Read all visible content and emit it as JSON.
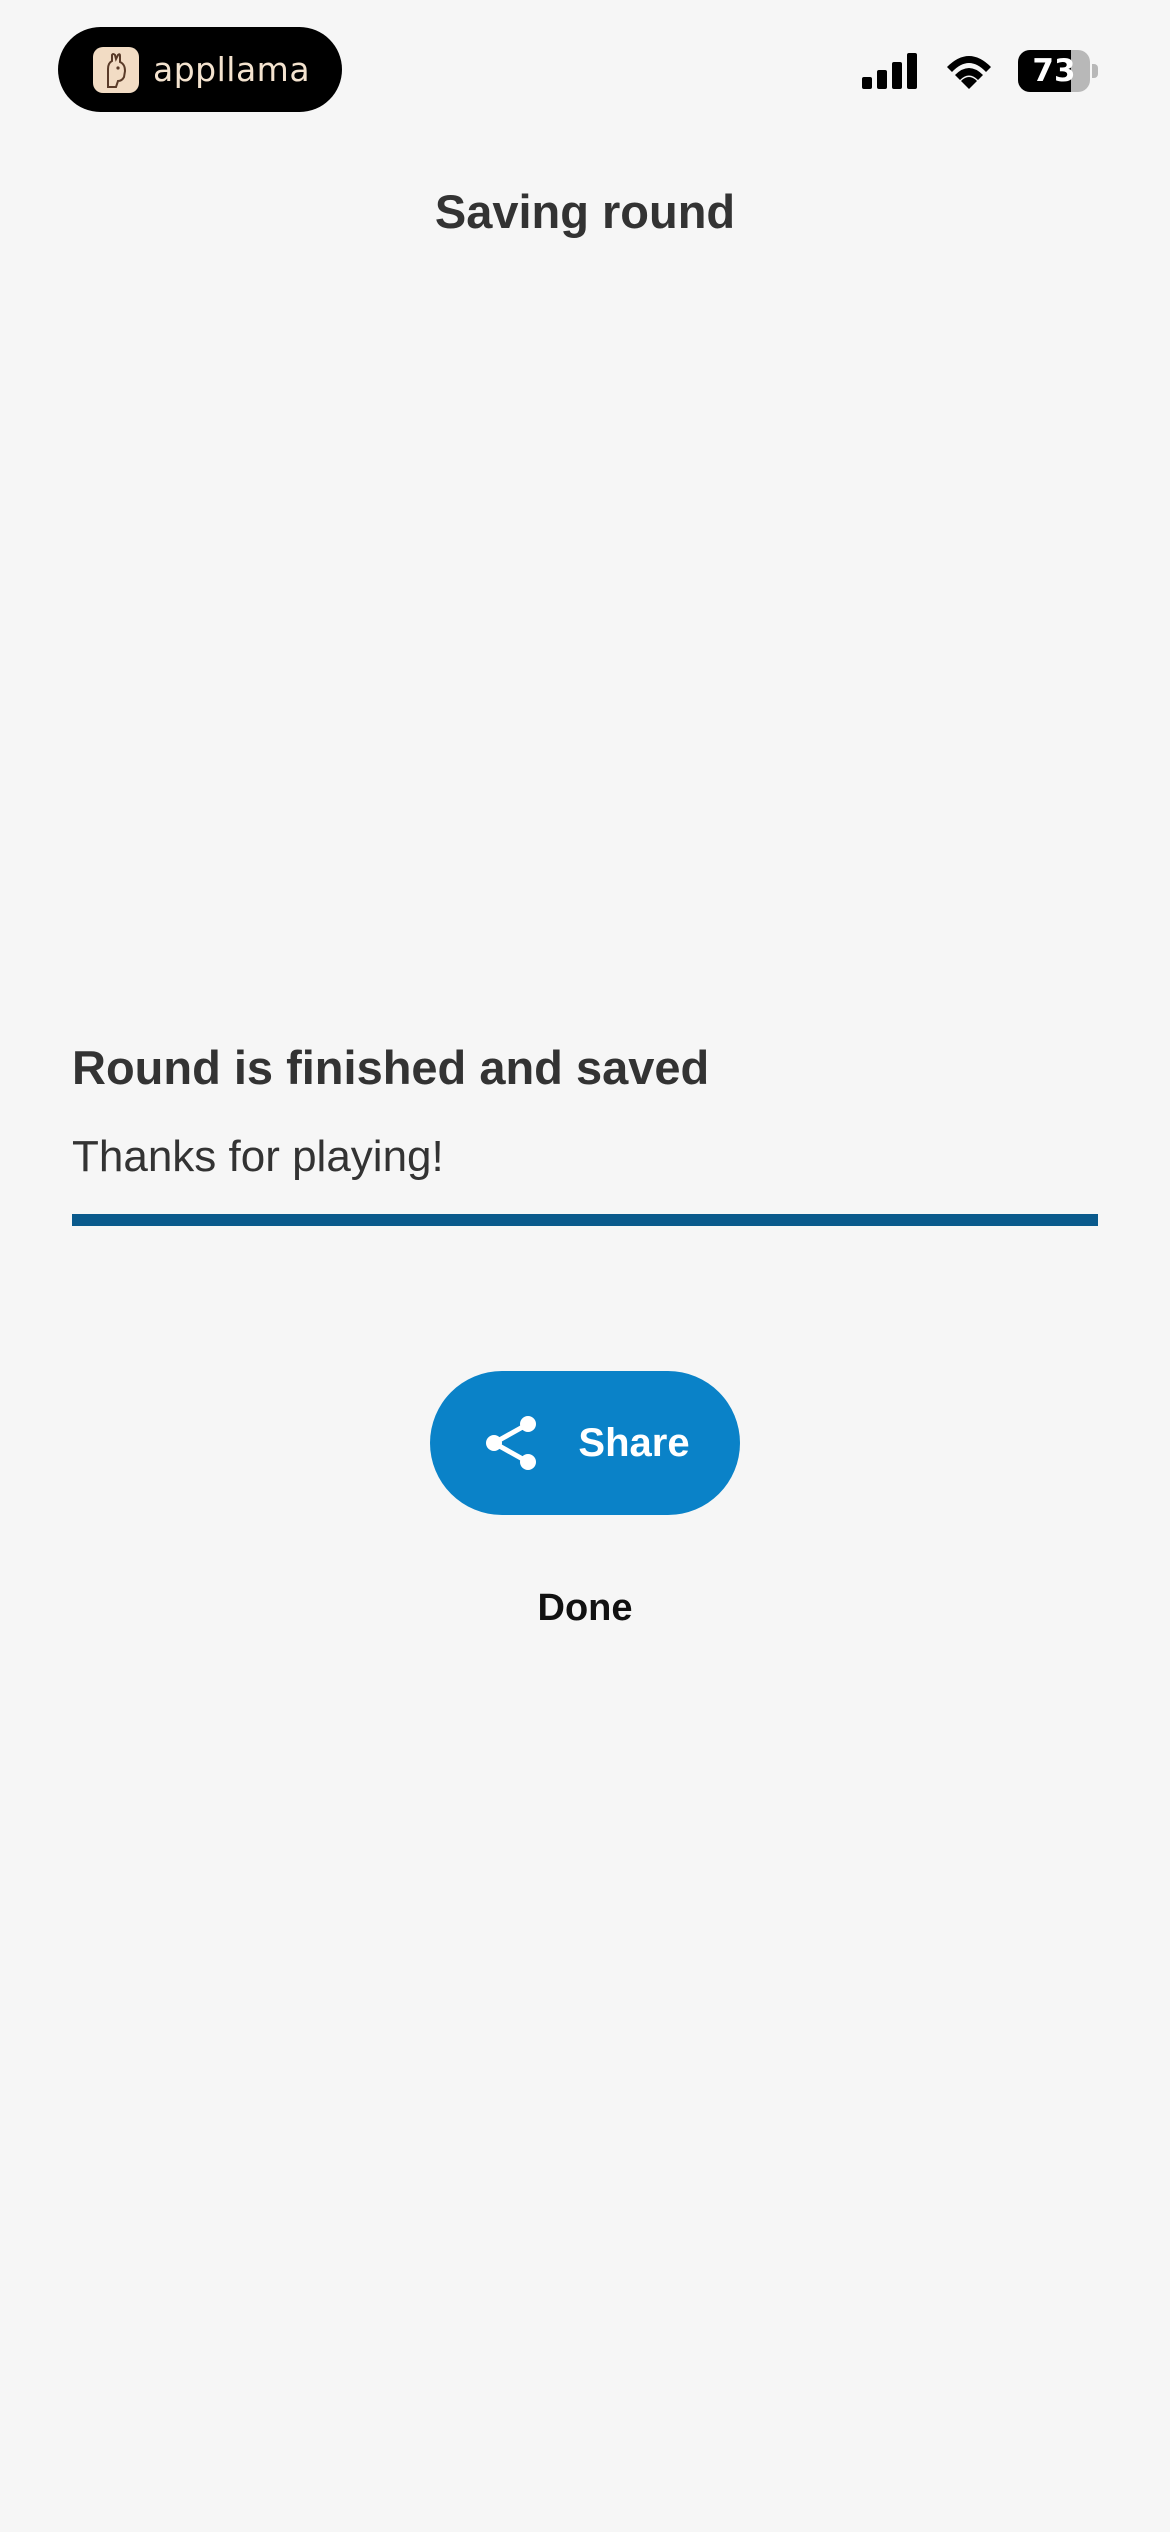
{
  "status_bar": {
    "brand_label": "appllama",
    "battery_level": "73",
    "battery_fraction": 0.73
  },
  "header": {
    "title": "Saving round"
  },
  "result": {
    "heading": "Round is finished and saved",
    "message": "Thanks for playing!",
    "progress": 1.0
  },
  "actions": {
    "share_label": "Share",
    "done_label": "Done"
  },
  "icons": {
    "brand": "llama-icon",
    "signal": "cellular-signal-icon",
    "wifi": "wifi-icon",
    "battery": "battery-icon",
    "share": "share-icon"
  },
  "colors": {
    "background": "#f6f6f6",
    "progress_fill": "#0a5a8c",
    "share_button": "#0a82c8",
    "text": "#333333"
  }
}
